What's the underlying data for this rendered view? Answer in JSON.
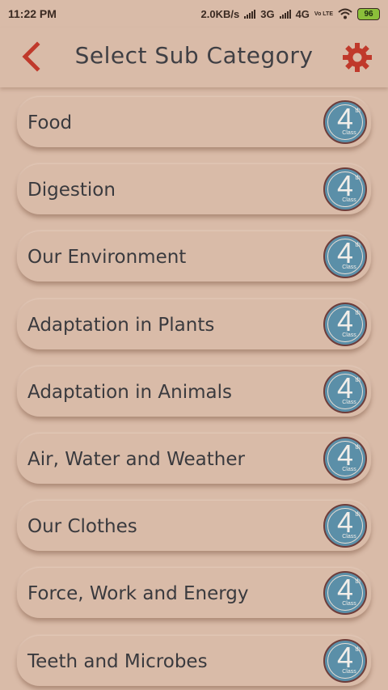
{
  "status_bar": {
    "time": "11:22 PM",
    "speed": "2.0KB/s",
    "net1": "3G",
    "net2": "4G",
    "volte": "Vo LTE",
    "battery": "96"
  },
  "header": {
    "title": "Select Sub Category",
    "back_icon": "chevron-left-icon",
    "settings_icon": "gear-icon",
    "accent_color": "#c0392b"
  },
  "badge": {
    "number": "4",
    "suffix": "th",
    "word": "Class",
    "color": "#5b8fa8"
  },
  "items": [
    {
      "label": "Food"
    },
    {
      "label": "Digestion"
    },
    {
      "label": "Our Environment"
    },
    {
      "label": "Adaptation in Plants"
    },
    {
      "label": "Adaptation in Animals"
    },
    {
      "label": "Air, Water and Weather"
    },
    {
      "label": "Our Clothes"
    },
    {
      "label": "Force, Work and Energy"
    },
    {
      "label": "Teeth and Microbes"
    }
  ]
}
